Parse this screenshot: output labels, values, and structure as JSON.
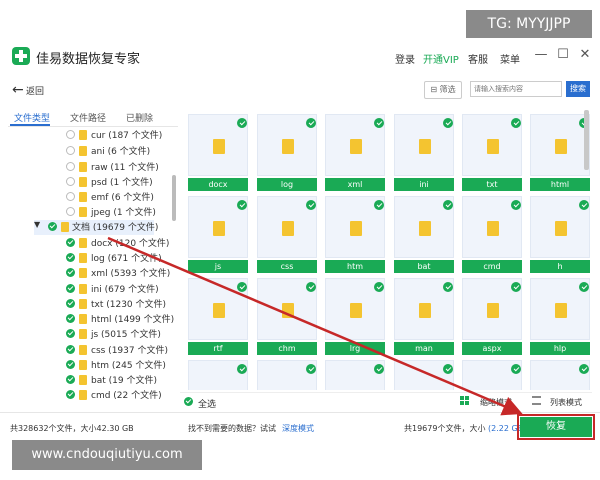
{
  "watermark_top": "TG: MYYJJPP",
  "watermark_bottom": "www.cndouqiutiyu.com",
  "app": {
    "title": "佳易数据恢复专家",
    "login": "登录",
    "vip": "开通VIP",
    "service": "客服",
    "menu": "菜单"
  },
  "colors": {
    "accent": "#1aaa55",
    "link": "#2a6ecf",
    "highlight": "#c62828",
    "vip": "#1aaa55"
  },
  "toolbar": {
    "back_label": "返回",
    "filter_label": "筛选",
    "search_placeholder": "请输入搜索内容",
    "search_button": "搜索"
  },
  "left_tabs": [
    "文件类型",
    "文件路径",
    "已删除"
  ],
  "tree": {
    "upper": [
      {
        "label": "cur (187 个文件)",
        "checked": false
      },
      {
        "label": "ani (6 个文件)",
        "checked": false
      },
      {
        "label": "raw (11 个文件)",
        "checked": false
      },
      {
        "label": "psd (1 个文件)",
        "checked": false
      },
      {
        "label": "emf (6 个文件)",
        "checked": false
      },
      {
        "label": "jpeg (1 个文件)",
        "checked": false
      }
    ],
    "folder": {
      "label": "文档 (19679 个文件)",
      "checked": true
    },
    "lower": [
      {
        "label": "docx (120 个文件)",
        "checked": true
      },
      {
        "label": "log (671 个文件)",
        "checked": true
      },
      {
        "label": "xml (5393 个文件)",
        "checked": true
      },
      {
        "label": "ini (679 个文件)",
        "checked": true
      },
      {
        "label": "txt (1230 个文件)",
        "checked": true
      },
      {
        "label": "html (1499 个文件)",
        "checked": true
      },
      {
        "label": "js (5015 个文件)",
        "checked": true
      },
      {
        "label": "css (1937 个文件)",
        "checked": true
      },
      {
        "label": "htm (245 个文件)",
        "checked": true
      },
      {
        "label": "bat (19 个文件)",
        "checked": true
      },
      {
        "label": "cmd (22 个文件)",
        "checked": true
      }
    ]
  },
  "grid": {
    "row1": [
      "docx",
      "log",
      "xml",
      "ini",
      "txt",
      "html"
    ],
    "row2": [
      "js",
      "css",
      "htm",
      "bat",
      "cmd",
      "h"
    ],
    "row3": [
      "rtf",
      "chm",
      "lrg",
      "man",
      "aspx",
      "hlp"
    ]
  },
  "footer": {
    "select_all": "全选",
    "thumb_mode": "缩略模式",
    "list_mode": "列表模式"
  },
  "status": {
    "left": "共328632个文件，大小42.30 GB",
    "mid": "找不到需要的数据？试试",
    "deep_mode": "深度模式",
    "right_prefix": "共19679个文件，大小",
    "right_size": "(2.22 GB)",
    "recover": "恢复"
  }
}
